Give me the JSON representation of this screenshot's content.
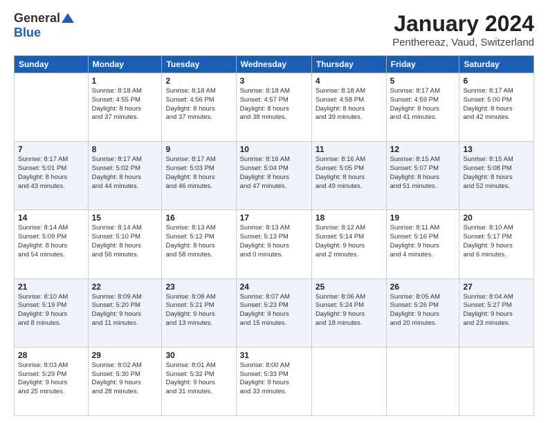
{
  "logo": {
    "general": "General",
    "blue": "Blue"
  },
  "title": "January 2024",
  "subtitle": "Penthereaz, Vaud, Switzerland",
  "headers": [
    "Sunday",
    "Monday",
    "Tuesday",
    "Wednesday",
    "Thursday",
    "Friday",
    "Saturday"
  ],
  "weeks": [
    [
      {
        "day": "",
        "info": ""
      },
      {
        "day": "1",
        "info": "Sunrise: 8:18 AM\nSunset: 4:55 PM\nDaylight: 8 hours\nand 37 minutes."
      },
      {
        "day": "2",
        "info": "Sunrise: 8:18 AM\nSunset: 4:56 PM\nDaylight: 8 hours\nand 37 minutes."
      },
      {
        "day": "3",
        "info": "Sunrise: 8:18 AM\nSunset: 4:57 PM\nDaylight: 8 hours\nand 38 minutes."
      },
      {
        "day": "4",
        "info": "Sunrise: 8:18 AM\nSunset: 4:58 PM\nDaylight: 8 hours\nand 39 minutes."
      },
      {
        "day": "5",
        "info": "Sunrise: 8:17 AM\nSunset: 4:59 PM\nDaylight: 8 hours\nand 41 minutes."
      },
      {
        "day": "6",
        "info": "Sunrise: 8:17 AM\nSunset: 5:00 PM\nDaylight: 8 hours\nand 42 minutes."
      }
    ],
    [
      {
        "day": "7",
        "info": "Sunrise: 8:17 AM\nSunset: 5:01 PM\nDaylight: 8 hours\nand 43 minutes."
      },
      {
        "day": "8",
        "info": "Sunrise: 8:17 AM\nSunset: 5:02 PM\nDaylight: 8 hours\nand 44 minutes."
      },
      {
        "day": "9",
        "info": "Sunrise: 8:17 AM\nSunset: 5:03 PM\nDaylight: 8 hours\nand 46 minutes."
      },
      {
        "day": "10",
        "info": "Sunrise: 8:16 AM\nSunset: 5:04 PM\nDaylight: 8 hours\nand 47 minutes."
      },
      {
        "day": "11",
        "info": "Sunrise: 8:16 AM\nSunset: 5:05 PM\nDaylight: 8 hours\nand 49 minutes."
      },
      {
        "day": "12",
        "info": "Sunrise: 8:15 AM\nSunset: 5:07 PM\nDaylight: 8 hours\nand 51 minutes."
      },
      {
        "day": "13",
        "info": "Sunrise: 8:15 AM\nSunset: 5:08 PM\nDaylight: 8 hours\nand 52 minutes."
      }
    ],
    [
      {
        "day": "14",
        "info": "Sunrise: 8:14 AM\nSunset: 5:09 PM\nDaylight: 8 hours\nand 54 minutes."
      },
      {
        "day": "15",
        "info": "Sunrise: 8:14 AM\nSunset: 5:10 PM\nDaylight: 8 hours\nand 56 minutes."
      },
      {
        "day": "16",
        "info": "Sunrise: 8:13 AM\nSunset: 5:12 PM\nDaylight: 8 hours\nand 58 minutes."
      },
      {
        "day": "17",
        "info": "Sunrise: 8:13 AM\nSunset: 5:13 PM\nDaylight: 9 hours\nand 0 minutes."
      },
      {
        "day": "18",
        "info": "Sunrise: 8:12 AM\nSunset: 5:14 PM\nDaylight: 9 hours\nand 2 minutes."
      },
      {
        "day": "19",
        "info": "Sunrise: 8:11 AM\nSunset: 5:16 PM\nDaylight: 9 hours\nand 4 minutes."
      },
      {
        "day": "20",
        "info": "Sunrise: 8:10 AM\nSunset: 5:17 PM\nDaylight: 9 hours\nand 6 minutes."
      }
    ],
    [
      {
        "day": "21",
        "info": "Sunrise: 8:10 AM\nSunset: 5:19 PM\nDaylight: 9 hours\nand 8 minutes."
      },
      {
        "day": "22",
        "info": "Sunrise: 8:09 AM\nSunset: 5:20 PM\nDaylight: 9 hours\nand 11 minutes."
      },
      {
        "day": "23",
        "info": "Sunrise: 8:08 AM\nSunset: 5:21 PM\nDaylight: 9 hours\nand 13 minutes."
      },
      {
        "day": "24",
        "info": "Sunrise: 8:07 AM\nSunset: 5:23 PM\nDaylight: 9 hours\nand 15 minutes."
      },
      {
        "day": "25",
        "info": "Sunrise: 8:06 AM\nSunset: 5:24 PM\nDaylight: 9 hours\nand 18 minutes."
      },
      {
        "day": "26",
        "info": "Sunrise: 8:05 AM\nSunset: 5:26 PM\nDaylight: 9 hours\nand 20 minutes."
      },
      {
        "day": "27",
        "info": "Sunrise: 8:04 AM\nSunset: 5:27 PM\nDaylight: 9 hours\nand 23 minutes."
      }
    ],
    [
      {
        "day": "28",
        "info": "Sunrise: 8:03 AM\nSunset: 5:29 PM\nDaylight: 9 hours\nand 25 minutes."
      },
      {
        "day": "29",
        "info": "Sunrise: 8:02 AM\nSunset: 5:30 PM\nDaylight: 9 hours\nand 28 minutes."
      },
      {
        "day": "30",
        "info": "Sunrise: 8:01 AM\nSunset: 5:32 PM\nDaylight: 9 hours\nand 31 minutes."
      },
      {
        "day": "31",
        "info": "Sunrise: 8:00 AM\nSunset: 5:33 PM\nDaylight: 9 hours\nand 33 minutes."
      },
      {
        "day": "",
        "info": ""
      },
      {
        "day": "",
        "info": ""
      },
      {
        "day": "",
        "info": ""
      }
    ]
  ]
}
